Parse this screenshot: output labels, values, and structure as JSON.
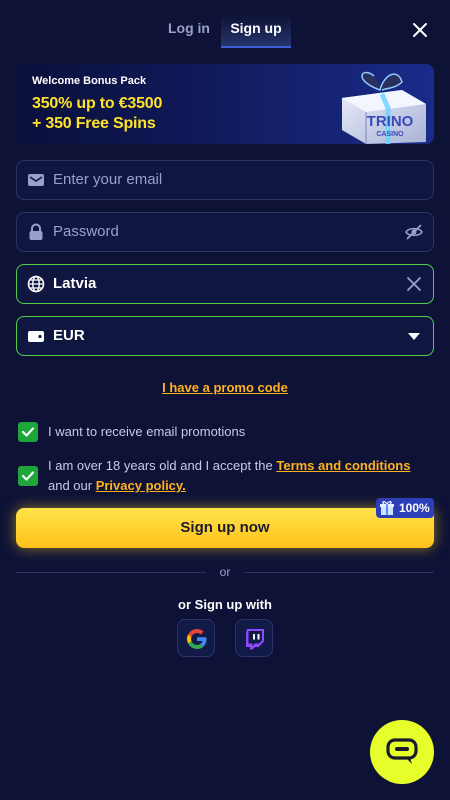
{
  "tabs": {
    "login": "Log in",
    "signup": "Sign up"
  },
  "banner": {
    "title": "Welcome Bonus Pack",
    "line1": "350% up to €3500",
    "line2": "+ 350 Free Spins",
    "brand": "TRINO",
    "brand_sub": "CASINO"
  },
  "form": {
    "email_placeholder": "Enter your email",
    "password_placeholder": "Password",
    "country_value": "Latvia",
    "currency_value": "EUR"
  },
  "promo_link": "I have a promo code",
  "checkboxes": {
    "email_promos": "I want to receive email promotions",
    "age_prefix": "I am over 18 years old and I accept the ",
    "terms_link": "Terms and conditions",
    "age_middle": "and our ",
    "privacy_link": "Privacy policy."
  },
  "signup_button": "Sign up now",
  "badge_value": "100%",
  "or_label": "or",
  "social_title": "or Sign up with",
  "social_providers": [
    "google-icon",
    "twitch-icon"
  ],
  "icons": [
    "close-icon",
    "mail-icon",
    "lock-icon",
    "eye-off-icon",
    "globe-icon",
    "clear-icon",
    "wallet-icon",
    "chevron-down-icon",
    "check-icon",
    "gift-icon",
    "chat-icon"
  ],
  "colors": {
    "background": "#0d1236",
    "accent_yellow": "#ffc21a",
    "link_orange": "#ffb21e",
    "valid_green": "#4fcf4a",
    "checkbox_green": "#1fa63a",
    "chat_button": "#e6ff2a"
  }
}
